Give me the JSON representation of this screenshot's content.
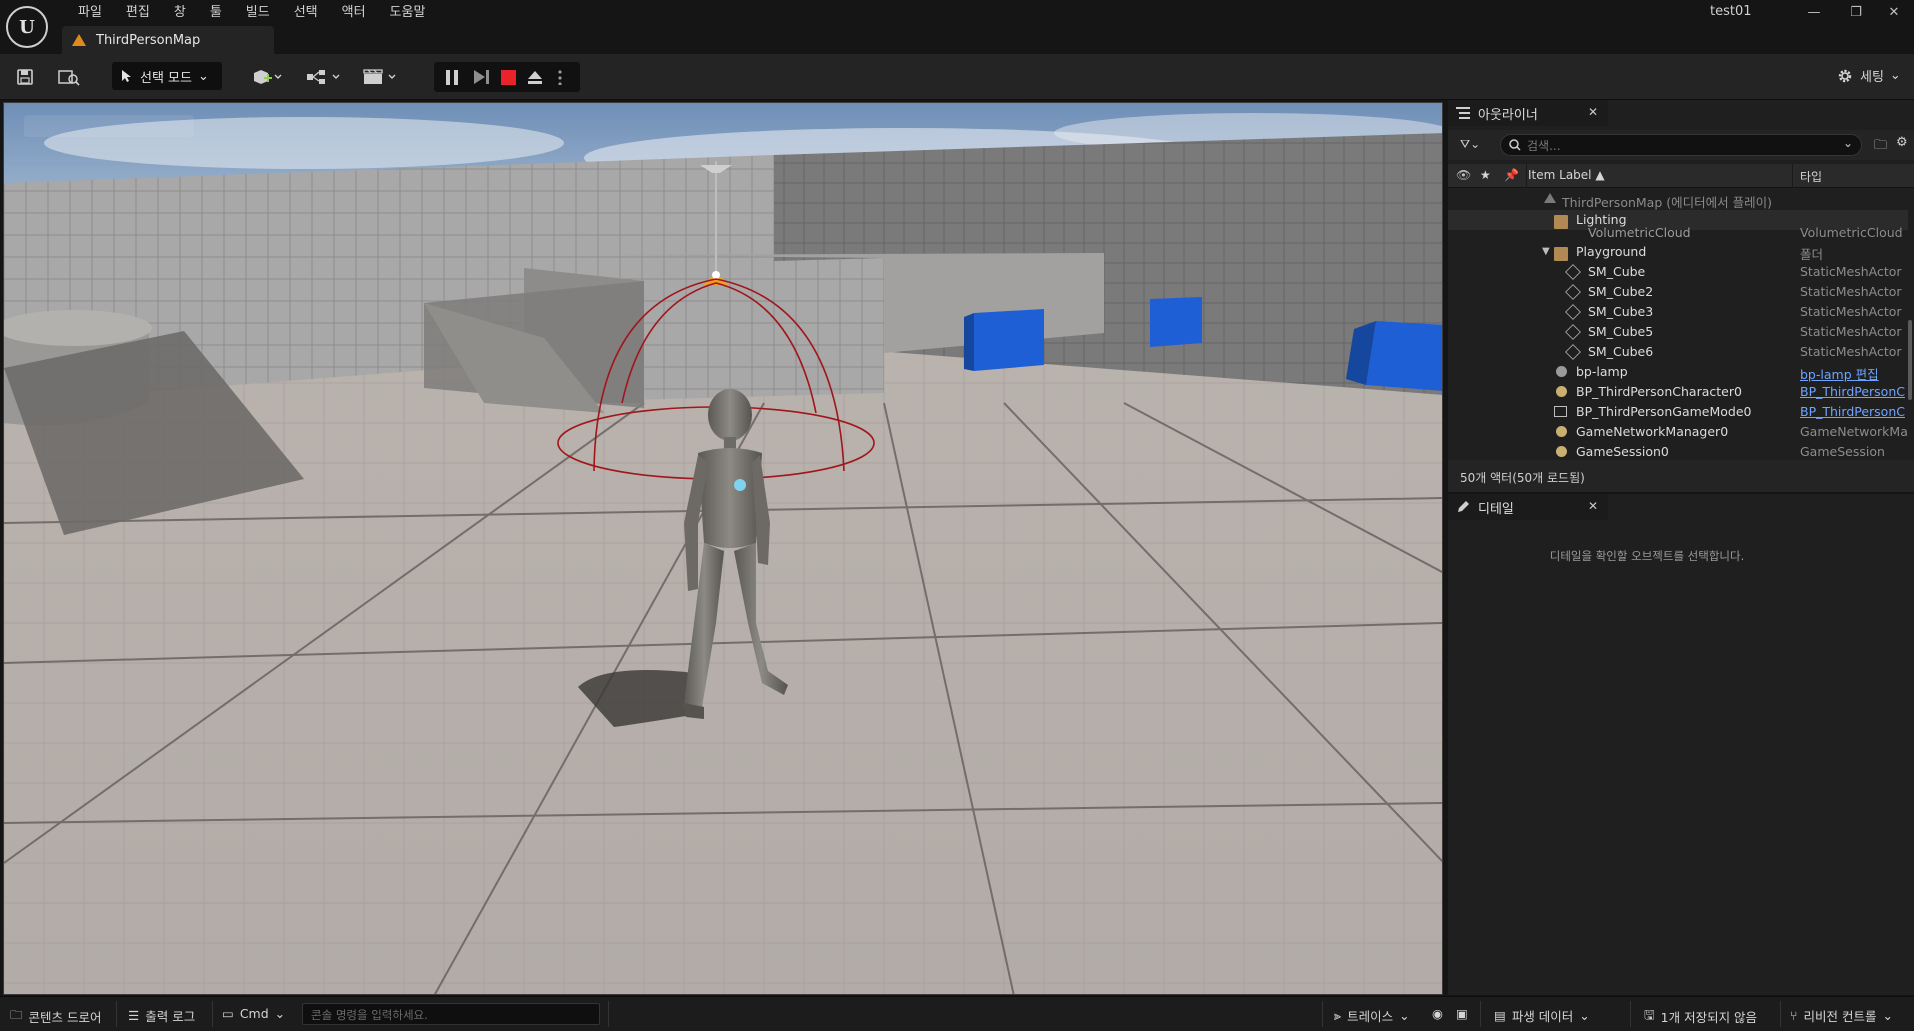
{
  "app": {
    "logo_text": "U",
    "project_name": "test01"
  },
  "menu": [
    "파일",
    "편집",
    "창",
    "툴",
    "빌드",
    "선택",
    "액터",
    "도움말"
  ],
  "map_tab": {
    "label": "ThirdPersonMap"
  },
  "window_controls": {
    "minimize": "—",
    "restore": "❐",
    "close": "✕"
  },
  "toolbar": {
    "mode_label": "선택 모드",
    "settings_label": "세팅"
  },
  "outliner": {
    "tab_label": "아웃라이너",
    "search_placeholder": "검색...",
    "col_label": "Item Label ▲",
    "col_type": "타입",
    "rows": [
      {
        "label": "ThirdPersonMap (에디터에서 플레이)",
        "type": "",
        "kind": "world"
      },
      {
        "label": "Lighting",
        "type": "",
        "kind": "folder"
      },
      {
        "label": "VolumetricCloud",
        "type": "VolumetricCloud",
        "kind": "actor"
      },
      {
        "label": "Playground",
        "type": "폴더",
        "kind": "folder"
      },
      {
        "label": "SM_Cube",
        "type": "StaticMeshActor",
        "kind": "mesh"
      },
      {
        "label": "SM_Cube2",
        "type": "StaticMeshActor",
        "kind": "mesh"
      },
      {
        "label": "SM_Cube3",
        "type": "StaticMeshActor",
        "kind": "mesh"
      },
      {
        "label": "SM_Cube5",
        "type": "StaticMeshActor",
        "kind": "mesh"
      },
      {
        "label": "SM_Cube6",
        "type": "StaticMeshActor",
        "kind": "mesh"
      },
      {
        "label": "bp-lamp",
        "type": "bp-lamp 편집",
        "kind": "bp"
      },
      {
        "label": "BP_ThirdPersonCharacter0",
        "type": "BP_ThirdPersonC",
        "kind": "bp"
      },
      {
        "label": "BP_ThirdPersonGameMode0",
        "type": "BP_ThirdPersonC",
        "kind": "bp"
      },
      {
        "label": "GameNetworkManager0",
        "type": "GameNetworkMa",
        "kind": "actor"
      },
      {
        "label": "GameSession0",
        "type": "GameSession",
        "kind": "actor"
      }
    ],
    "actor_count": "50개 액터(50개 로드됨)"
  },
  "details": {
    "tab_label": "디테일",
    "empty_message": "디테일을 확인할 오브젝트를 선택합니다."
  },
  "statusbar": {
    "content_drawer": "콘텐츠 드로어",
    "output_log": "출력 로그",
    "cmd_label": "Cmd",
    "cmd_placeholder": "콘솔 명령을 입력하세요.",
    "trace_label": "트레이스",
    "derived_data": "파생 데이터",
    "unsaved": "1개 저장되지 않음",
    "revision_control": "리비전 컨트롤"
  },
  "colors": {
    "accent_stop": "#e8242a",
    "link": "#6fa4ff",
    "cube_blue": "#1f5fd6",
    "lamp_orange": "#f0a020",
    "folder": "#b08a52"
  }
}
